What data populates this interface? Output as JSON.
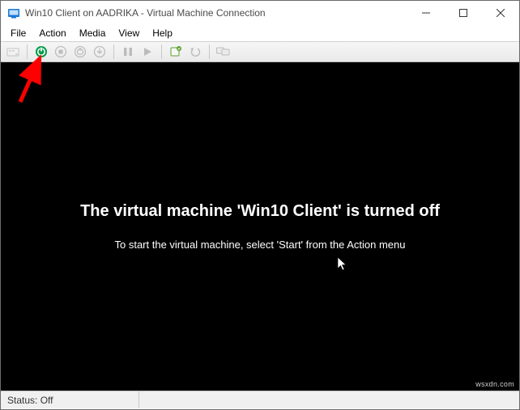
{
  "window": {
    "title": "Win10 Client on AADRIKA - Virtual Machine Connection"
  },
  "menu": {
    "file": "File",
    "action": "Action",
    "media": "Media",
    "view": "View",
    "help": "Help"
  },
  "toolbar": {
    "ctrlaltdel": "ctrl-alt-del",
    "start": "start",
    "shutdown": "shutdown",
    "save": "save",
    "pause_state": "pause-state",
    "pause": "pause",
    "resume": "resume",
    "checkpoint": "checkpoint",
    "revert": "revert",
    "enhanced": "enhanced-session"
  },
  "messages": {
    "heading": "The virtual machine 'Win10 Client' is turned off",
    "sub": "To start the virtual machine, select 'Start' from the Action menu"
  },
  "status": {
    "text": "Status: Off"
  },
  "watermark": "wsxdn.com",
  "colors": {
    "start_button": "#009a4a",
    "arrow": "#ff0000"
  }
}
